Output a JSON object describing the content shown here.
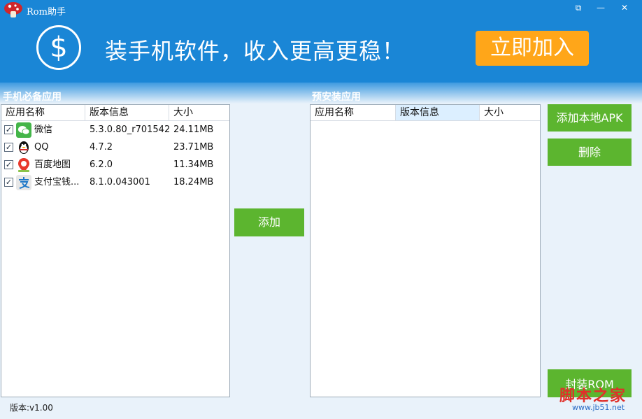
{
  "titlebar": {
    "app_title": "Rom助手",
    "controls": [
      "⧉",
      "—",
      "✕"
    ],
    "icons": {
      "logo": "mushroom-icon"
    }
  },
  "banner": {
    "dollar_symbol": "$",
    "slogan": "装手机软件，收入更高更稳！",
    "join_label": "立即加入",
    "colors": {
      "background": "#1a86d6",
      "join_button": "#ffa619"
    }
  },
  "left_panel": {
    "title": "手机必备应用",
    "columns": [
      "应用名称",
      "版本信息",
      "大小"
    ],
    "rows": [
      {
        "name": "微信",
        "version": "5.3.0.80_r701542",
        "size": "24.11MB",
        "checked": true,
        "icon": "wechat-icon"
      },
      {
        "name": "QQ",
        "version": "4.7.2",
        "size": "23.71MB",
        "checked": true,
        "icon": "qq-penguin-icon"
      },
      {
        "name": "百度地图",
        "version": "6.2.0",
        "size": "11.34MB",
        "checked": true,
        "icon": "baidu-map-pin-icon"
      },
      {
        "name": "支付宝钱...",
        "version": "8.1.0.043001",
        "size": "18.24MB",
        "checked": true,
        "icon": "alipay-icon"
      }
    ]
  },
  "add_button": "添加",
  "right_panel": {
    "title": "预安装应用",
    "columns": [
      "应用名称",
      "版本信息",
      "大小"
    ]
  },
  "side_buttons": {
    "add_local_apk": "添加本地APK",
    "delete": "删除",
    "pack_rom": "封装ROM",
    "color": "#5cb52f"
  },
  "status": {
    "version": "版本:v1.00"
  },
  "watermark": {
    "text": "脚本之家",
    "url": "www.jb51.net"
  }
}
